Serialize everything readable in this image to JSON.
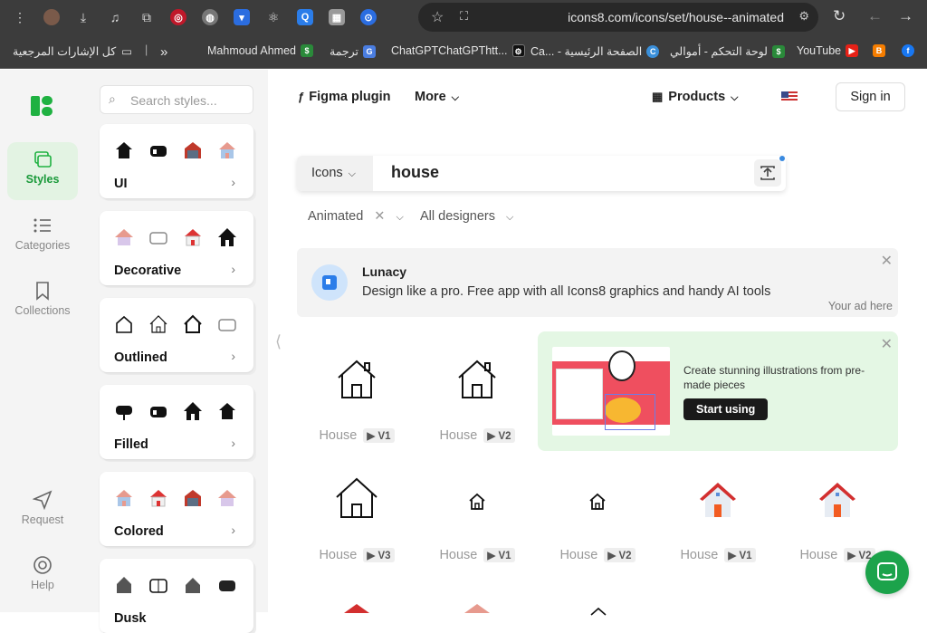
{
  "browser": {
    "url": "icons8.com/icons/set/house--animated",
    "bookmarks": [
      {
        "label": "كل الإشارات المرجعية",
        "icon": "folder-icon"
      },
      {
        "label": "»",
        "icon": "overflow-icon"
      },
      {
        "label": "Mahmoud Ahmed",
        "icon": "dollar-icon"
      },
      {
        "label": "ترجمة",
        "icon": "translate-icon"
      },
      {
        "label": "ChatGPTChatGPThtt...",
        "icon": "openai-icon"
      },
      {
        "label": "Ca... - الصفحة الرئيسية",
        "icon": "canva-icon"
      },
      {
        "label": "لوحة التحكم - أموالي",
        "icon": "dollar-icon"
      },
      {
        "label": "YouTube",
        "icon": "youtube-icon"
      },
      {
        "label": "",
        "icon": "blogger-icon"
      },
      {
        "label": "",
        "icon": "facebook-icon"
      }
    ]
  },
  "rail": {
    "items": [
      {
        "label": "Styles",
        "icon": "styles-icon",
        "active": true
      },
      {
        "label": "Categories",
        "icon": "categories-icon"
      },
      {
        "label": "Collections",
        "icon": "bookmark-icon"
      },
      {
        "label": "Request",
        "icon": "send-icon"
      },
      {
        "label": "Help",
        "icon": "lifebuoy-icon"
      }
    ]
  },
  "styles_panel": {
    "search_placeholder": "Search styles...",
    "cards": [
      {
        "title": "UI"
      },
      {
        "title": "Decorative"
      },
      {
        "title": "Outlined"
      },
      {
        "title": "Filled"
      },
      {
        "title": "Colored"
      },
      {
        "title": "Dusk"
      }
    ]
  },
  "header": {
    "figma_plugin": "Figma plugin",
    "more": "More",
    "products": "Products",
    "sign_in": "Sign in"
  },
  "search": {
    "category": "Icons",
    "query": "house"
  },
  "filters": {
    "animated": "Animated",
    "designers": "All designers"
  },
  "ad": {
    "title": "Lunacy",
    "description": "Design like a pro. Free app with all Icons8 graphics and handy AI tools",
    "note": "Your ad here"
  },
  "promo": {
    "text": "Create stunning illustrations from pre-made pieces",
    "button": "Start using"
  },
  "results": [
    {
      "name": "House",
      "version": "V1",
      "style": "outline"
    },
    {
      "name": "House",
      "version": "V2",
      "style": "outline"
    },
    {
      "name": "House",
      "version": "V3",
      "style": "outline"
    },
    {
      "name": "House",
      "version": "V1",
      "style": "small"
    },
    {
      "name": "House",
      "version": "V2",
      "style": "small"
    },
    {
      "name": "House",
      "version": "V1",
      "style": "color"
    },
    {
      "name": "House",
      "version": "V2",
      "style": "color"
    }
  ],
  "colors": {
    "accent_green": "#1ca34b",
    "brand_green": "#1fb141",
    "promo_bg": "#e4f7e4"
  }
}
